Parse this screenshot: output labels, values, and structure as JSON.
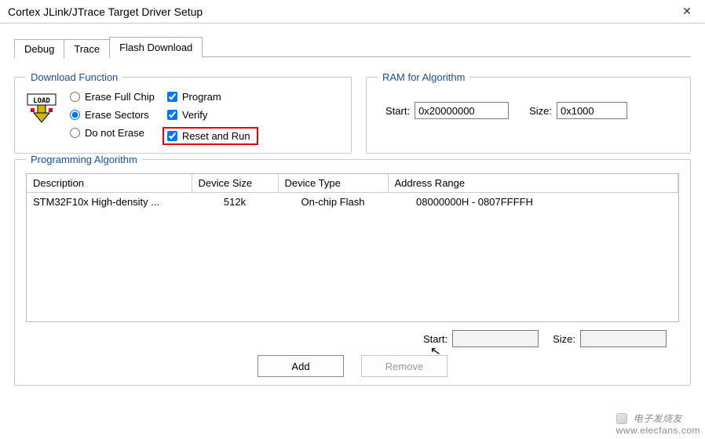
{
  "window": {
    "title": "Cortex JLink/JTrace Target Driver Setup"
  },
  "tabs": [
    {
      "label": "Debug",
      "active": false
    },
    {
      "label": "Trace",
      "active": false
    },
    {
      "label": "Flash Download",
      "active": true
    }
  ],
  "download_function": {
    "legend": "Download Function",
    "erase": {
      "full_chip": "Erase Full Chip",
      "sectors": "Erase Sectors",
      "do_not": "Do not Erase",
      "selected": "sectors"
    },
    "options": {
      "program": {
        "label": "Program",
        "checked": true
      },
      "verify": {
        "label": "Verify",
        "checked": true
      },
      "reset_and_run": {
        "label": "Reset and Run",
        "checked": true,
        "highlighted": true
      }
    }
  },
  "ram_for_algorithm": {
    "legend": "RAM for Algorithm",
    "start_label": "Start:",
    "start_value": "0x20000000",
    "size_label": "Size:",
    "size_value": "0x1000"
  },
  "programming_algorithm": {
    "legend": "Programming Algorithm",
    "columns": [
      "Description",
      "Device Size",
      "Device Type",
      "Address Range"
    ],
    "rows": [
      {
        "description": "STM32F10x High-density ...",
        "device_size": "512k",
        "device_type": "On-chip Flash",
        "address_range": "08000000H - 0807FFFFH"
      }
    ],
    "start_label": "Start:",
    "start_value": "",
    "size_label": "Size:",
    "size_value": ""
  },
  "buttons": {
    "add": "Add",
    "remove": "Remove"
  },
  "watermark": {
    "text": "电子发烧友",
    "url": "www.elecfans.com"
  }
}
